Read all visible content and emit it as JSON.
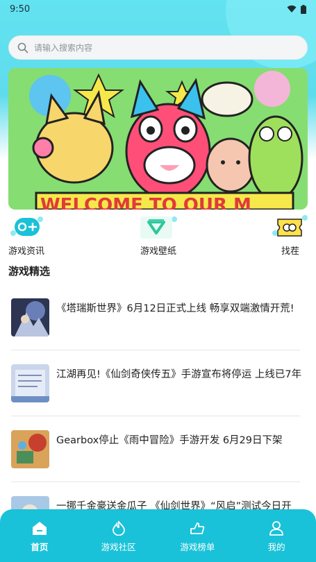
{
  "status_bar": {
    "time": "9:50"
  },
  "search": {
    "placeholder": "请输入搜索内容"
  },
  "banner": {
    "text": "WELCOME TO OUR M"
  },
  "shortcuts": [
    {
      "label": "游戏资讯",
      "icon": "gamepad-icon"
    },
    {
      "label": "游戏壁纸",
      "icon": "wallpaper-icon"
    },
    {
      "label": "找茬",
      "icon": "find-difference-icon"
    }
  ],
  "section": {
    "title": "游戏精选"
  },
  "news": [
    {
      "title": "《塔瑞斯世界》6月12日正式上线 畅享双端激情开荒!"
    },
    {
      "title": "江湖再见!《仙剑奇侠传五》手游宣布将停运 上线已7年"
    },
    {
      "title": "Gearbox停止《雨中冒险》手游开发 6月29日下架"
    },
    {
      "title": "一挪千金豪送金瓜子 《仙剑世界》“风启”测试今日开"
    }
  ],
  "tabs": [
    {
      "label": "首页",
      "icon": "home-icon",
      "active": true
    },
    {
      "label": "游戏社区",
      "icon": "flame-icon",
      "active": false
    },
    {
      "label": "游戏榜单",
      "icon": "hand-icon",
      "active": false
    },
    {
      "label": "我的",
      "icon": "user-icon",
      "active": false
    }
  ],
  "colors": {
    "accent": "#19c2d8",
    "header": "#62e3f0"
  }
}
